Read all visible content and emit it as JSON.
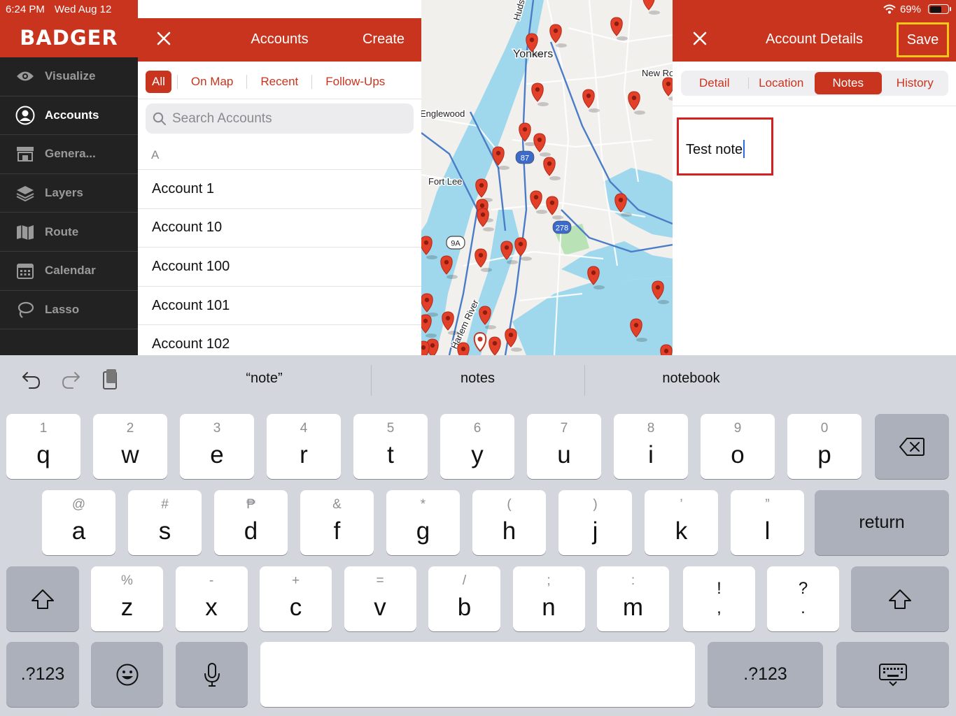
{
  "status": {
    "time": "6:24 PM",
    "date": "Wed Aug 12",
    "battery": "69%",
    "battery_level": 0.69
  },
  "sidebar": {
    "brand": "BADGER",
    "items": [
      {
        "label": "Visualize",
        "icon": "eye-icon"
      },
      {
        "label": "Accounts",
        "icon": "user-circle-icon",
        "active": true
      },
      {
        "label": "Genera...",
        "icon": "store-icon"
      },
      {
        "label": "Layers",
        "icon": "layers-icon"
      },
      {
        "label": "Route",
        "icon": "map-icon"
      },
      {
        "label": "Calendar",
        "icon": "calendar-icon"
      },
      {
        "label": "Lasso",
        "icon": "lasso-icon"
      }
    ]
  },
  "accounts": {
    "title": "Accounts",
    "create": "Create",
    "filters": [
      "All",
      "On Map",
      "Recent",
      "Follow-Ups"
    ],
    "active_filter": "All",
    "search_placeholder": "Search Accounts",
    "section": "A",
    "items": [
      "Account 1",
      "Account 10",
      "Account 100",
      "Account 101",
      "Account 102"
    ]
  },
  "map": {
    "labels": [
      "Huds",
      "Yonkers",
      "New Ro",
      "Englewood",
      "Fort Lee",
      "Harlem River"
    ],
    "shields": [
      "87",
      "278",
      "9A"
    ]
  },
  "details": {
    "title": "Account Details",
    "save": "Save",
    "tabs": [
      "Detail",
      "Location",
      "Notes",
      "History"
    ],
    "active_tab": "Notes",
    "note_text": "Test note"
  },
  "keyboard": {
    "suggestions": [
      "“note”",
      "notes",
      "notebook"
    ],
    "row1": [
      {
        "hint": "1",
        "key": "q"
      },
      {
        "hint": "2",
        "key": "w"
      },
      {
        "hint": "3",
        "key": "e"
      },
      {
        "hint": "4",
        "key": "r"
      },
      {
        "hint": "5",
        "key": "t"
      },
      {
        "hint": "6",
        "key": "y"
      },
      {
        "hint": "7",
        "key": "u"
      },
      {
        "hint": "8",
        "key": "i"
      },
      {
        "hint": "9",
        "key": "o"
      },
      {
        "hint": "0",
        "key": "p"
      }
    ],
    "row2": [
      {
        "hint": "@",
        "key": "a"
      },
      {
        "hint": "#",
        "key": "s"
      },
      {
        "hint": "₱",
        "key": "d"
      },
      {
        "hint": "&",
        "key": "f"
      },
      {
        "hint": "*",
        "key": "g"
      },
      {
        "hint": "(",
        "key": "h"
      },
      {
        "hint": ")",
        "key": "j"
      },
      {
        "hint": "’",
        "key": "k"
      },
      {
        "hint": "”",
        "key": "l"
      }
    ],
    "row3": [
      {
        "hint": "%",
        "key": "z"
      },
      {
        "hint": "-",
        "key": "x"
      },
      {
        "hint": "+",
        "key": "c"
      },
      {
        "hint": "=",
        "key": "v"
      },
      {
        "hint": "/",
        "key": "b"
      },
      {
        "hint": ";",
        "key": "n"
      },
      {
        "hint": ":",
        "key": "m"
      }
    ],
    "punct": [
      {
        "top": "!",
        "bottom": ","
      },
      {
        "top": "?",
        "bottom": "."
      }
    ],
    "return": "return",
    "numbers": ".?123"
  }
}
